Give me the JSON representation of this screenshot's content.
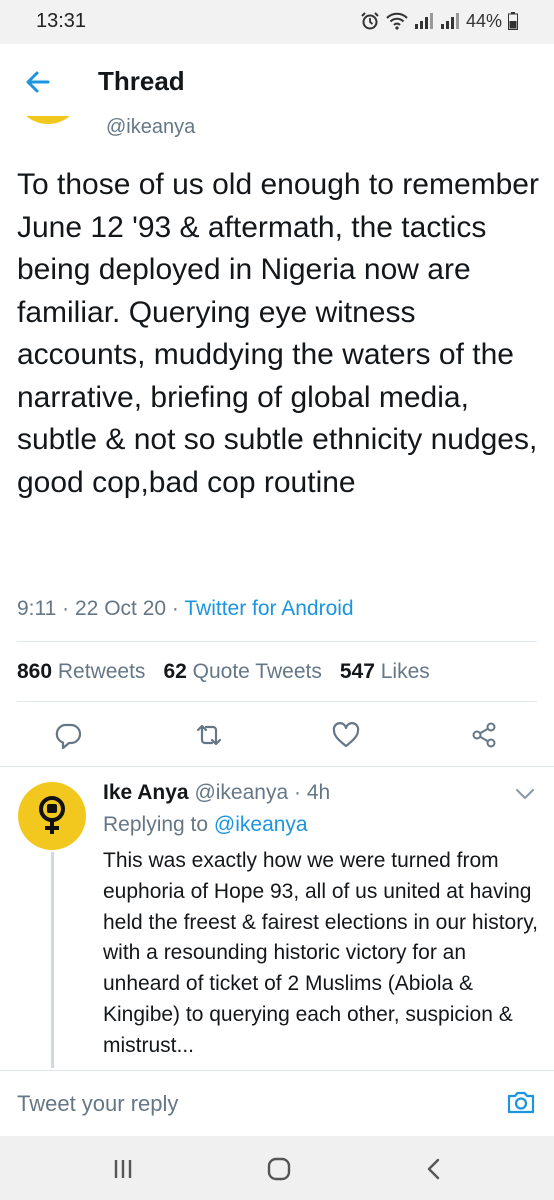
{
  "status_bar": {
    "time": "13:31",
    "battery": "44%",
    "icons": [
      "alarm-icon",
      "wifi-icon",
      "signal-icon",
      "signal-icon",
      "battery-icon"
    ]
  },
  "header": {
    "back_icon": "back-arrow-icon",
    "title": "Thread"
  },
  "main_tweet": {
    "handle": "@ikeanya",
    "text": "To those of us old enough to remember June 12 '93 & aftermath, the tactics being deployed in Nigeria now are familiar. Querying eye witness accounts, muddying the waters of the narrative, briefing of global media, subtle & not so subtle ethnicity nudges, good cop,bad cop routine",
    "time": "9:11",
    "date": "22 Oct 20",
    "source": "Twitter for Android",
    "stats": {
      "retweets_count": "860",
      "retweets_label": "Retweets",
      "quotes_count": "62",
      "quotes_label": "Quote Tweets",
      "likes_count": "547",
      "likes_label": "Likes"
    },
    "actions": [
      "reply-icon",
      "retweet-icon",
      "like-icon",
      "share-icon"
    ]
  },
  "reply": {
    "name": "Ike Anya",
    "handle": "@ikeanya",
    "age": "4h",
    "replying_prefix": "Replying to",
    "replying_to": "@ikeanya",
    "text": "This was exactly how we were turned from euphoria of Hope 93, all of us united at having held the freest & fairest elections in our history, with a resounding historic victory for an unheard of ticket of 2 Muslims (Abiola & Kingibe) to querying each other, suspicion & mistrust..."
  },
  "compose": {
    "placeholder": "Tweet your reply",
    "camera_icon": "camera-icon"
  },
  "nav_bar": {
    "buttons": [
      "recent-apps-icon",
      "home-icon",
      "back-icon"
    ]
  },
  "colors": {
    "accent": "#1b95e0",
    "avatar_yellow": "#f2c81e",
    "secondary_text": "#657786",
    "divider": "#e1e8ed"
  }
}
